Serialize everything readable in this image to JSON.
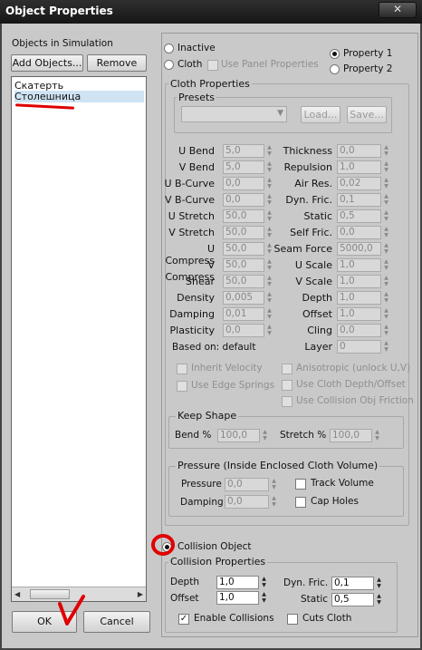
{
  "window": {
    "title": "Object Properties",
    "close": "✕"
  },
  "left": {
    "objects_label": "Objects in Simulation",
    "add_objects": "Add Objects...",
    "remove": "Remove",
    "objects": [
      "Скатерть",
      "Столешница"
    ],
    "selected_index": 1,
    "ok": "OK",
    "cancel": "Cancel"
  },
  "mode": {
    "inactive": "Inactive",
    "cloth": "Cloth",
    "use_panel_props": "Use Panel Properties",
    "property1": "Property 1",
    "property2": "Property 2"
  },
  "cloth": {
    "group_title": "Cloth Properties",
    "presets_title": "Presets",
    "load": "Load...",
    "save": "Save...",
    "left_params": [
      {
        "label": "U Bend",
        "value": "5,0"
      },
      {
        "label": "V Bend",
        "value": "5,0"
      },
      {
        "label": "U B-Curve",
        "value": "0,0"
      },
      {
        "label": "V B-Curve",
        "value": "0,0"
      },
      {
        "label": "U Stretch",
        "value": "50,0"
      },
      {
        "label": "V Stretch",
        "value": "50,0"
      },
      {
        "label": "U Compress",
        "value": "50,0"
      },
      {
        "label": "V Compress",
        "value": "50,0"
      },
      {
        "label": "Shear",
        "value": "50,0"
      },
      {
        "label": "Density",
        "value": "0,005"
      },
      {
        "label": "Damping",
        "value": "0,01"
      },
      {
        "label": "Plasticity",
        "value": "0,0"
      }
    ],
    "right_params": [
      {
        "label": "Thickness",
        "value": "0,0"
      },
      {
        "label": "Repulsion",
        "value": "1,0"
      },
      {
        "label": "Air Res.",
        "value": "0,02"
      },
      {
        "label": "Dyn. Fric.",
        "value": "0,1"
      },
      {
        "label": "Static",
        "value": "0,5"
      },
      {
        "label": "Self Fric.",
        "value": "0,0"
      },
      {
        "label": "Seam Force",
        "value": "5000,0"
      },
      {
        "label": "U Scale",
        "value": "1,0"
      },
      {
        "label": "V Scale",
        "value": "1,0"
      },
      {
        "label": "Depth",
        "value": "1,0"
      },
      {
        "label": "Offset",
        "value": "1,0"
      },
      {
        "label": "Cling",
        "value": "0,0"
      },
      {
        "label": "Layer",
        "value": "0"
      }
    ],
    "based_on": "Based on: default",
    "inherit_velocity": "Inherit Velocity",
    "use_edge_springs": "Use Edge Springs",
    "anisotropic": "Anisotropic (unlock U,V)",
    "use_cloth_depth": "Use Cloth Depth/Offset",
    "use_collision_friction": "Use Collision Obj Friction"
  },
  "keep_shape": {
    "title": "Keep Shape",
    "bend_label": "Bend %",
    "bend_value": "100,0",
    "stretch_label": "Stretch %",
    "stretch_value": "100,0"
  },
  "pressure": {
    "title": "Pressure (Inside Enclosed Cloth Volume)",
    "pressure_label": "Pressure",
    "pressure_value": "0,0",
    "damping_label": "Damping",
    "damping_value": "0,0",
    "track_volume": "Track Volume",
    "cap_holes": "Cap Holes"
  },
  "collision": {
    "radio_label": "Collision Object",
    "group_title": "Collision Properties",
    "depth_label": "Depth",
    "depth_value": "1,0",
    "offset_label": "Offset",
    "offset_value": "1,0",
    "dyn_fric_label": "Dyn. Fric.",
    "dyn_fric_value": "0,1",
    "static_label": "Static",
    "static_value": "0,5",
    "enable_collisions": "Enable Collisions",
    "enable_checked": "✓",
    "cuts_cloth": "Cuts Cloth"
  },
  "annotation_colors": {
    "marker": "#e00000"
  }
}
